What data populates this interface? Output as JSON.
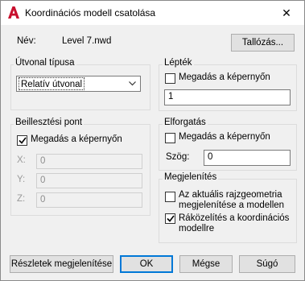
{
  "window": {
    "title": "Koordinációs modell csatolása",
    "close_glyph": "✕",
    "accent": "#0078d7",
    "app_icon": "autocad-a-icon"
  },
  "name_row": {
    "label": "Név:",
    "value": "Level 7.nwd",
    "browse_button": "Tallózás..."
  },
  "path_type": {
    "group_title": "Útvonal típusa",
    "selected": "Relatív útvonal"
  },
  "insertion_point": {
    "group_title": "Beillesztési pont",
    "specify_on_screen": "Megadás a képernyőn",
    "specify_checked": true,
    "fields": [
      {
        "label": "X:",
        "value": "0"
      },
      {
        "label": "Y:",
        "value": "0"
      },
      {
        "label": "Z:",
        "value": "0"
      }
    ]
  },
  "scale": {
    "group_title": "Lépték",
    "specify_on_screen": "Megadás a képernyőn",
    "specify_checked": false,
    "value": "1"
  },
  "rotation": {
    "group_title": "Elforgatás",
    "specify_on_screen": "Megadás a képernyőn",
    "specify_checked": false,
    "angle_label": "Szög:",
    "angle_value": "0"
  },
  "display": {
    "group_title": "Megjelenítés",
    "option1": "Az aktuális rajzgeometria megjelenítése a modellen",
    "option1_checked": false,
    "option2": "Ráközelítés a koordinációs modellre",
    "option2_checked": true
  },
  "buttons": {
    "details": "Részletek megjelenítése",
    "ok": "OK",
    "cancel": "Mégse",
    "help": "Súgó"
  }
}
